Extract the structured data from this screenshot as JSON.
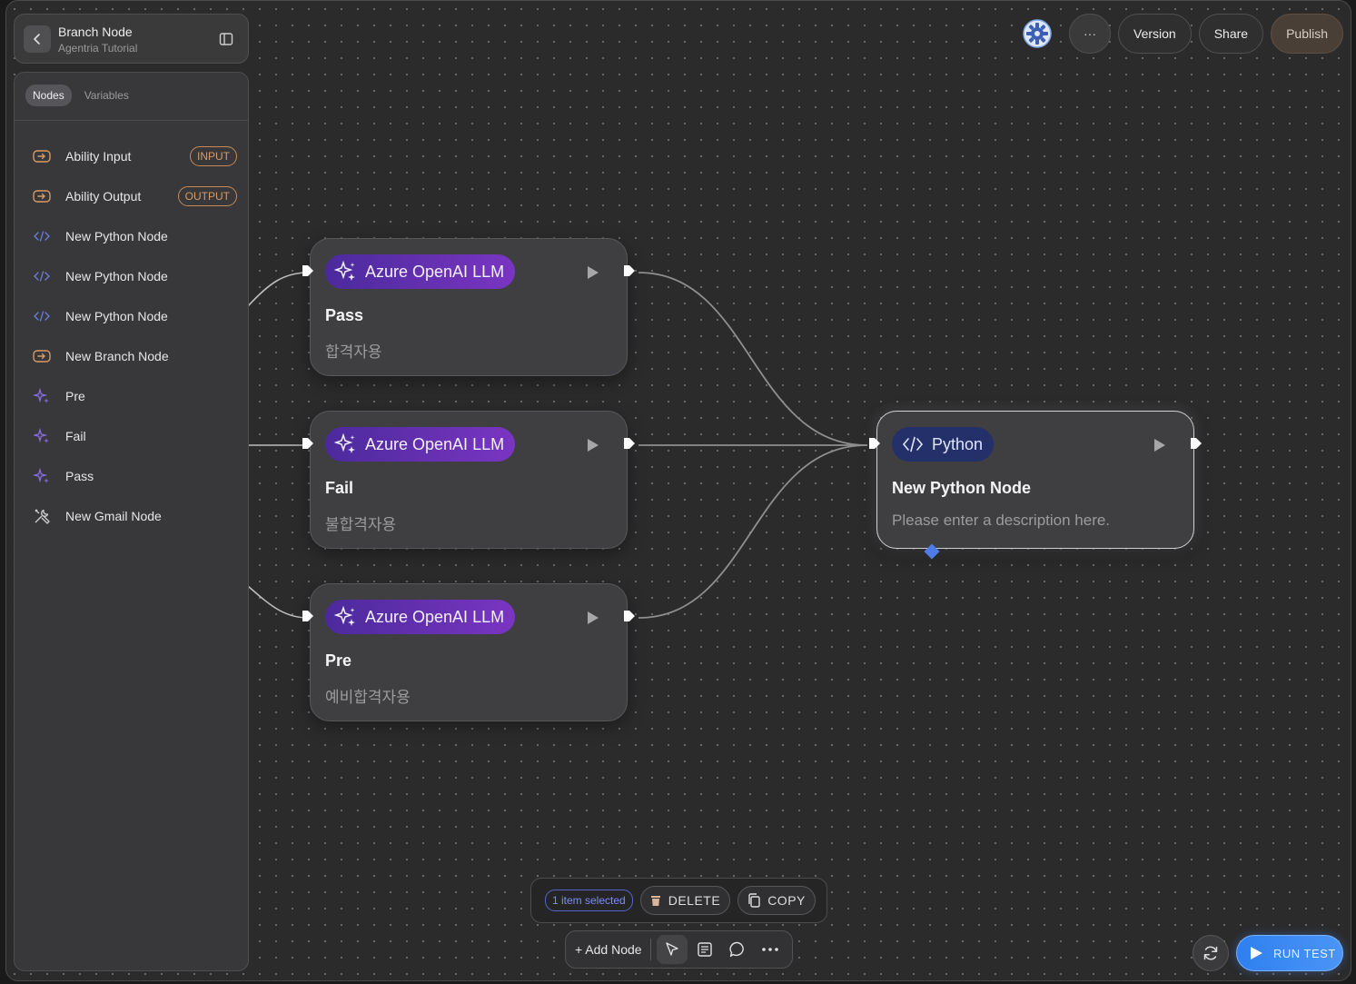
{
  "header": {
    "title": "Branch Node",
    "subtitle": "Agentria Tutorial"
  },
  "side_panel": {
    "tabs": [
      {
        "label": "Nodes",
        "active": true
      },
      {
        "label": "Variables",
        "active": false
      }
    ],
    "items": [
      {
        "label": "Ability Input",
        "icon": "io-arrow-icon",
        "badge": "INPUT"
      },
      {
        "label": "Ability Output",
        "icon": "io-arrow-icon",
        "badge": "OUTPUT"
      },
      {
        "label": "New Python Node",
        "icon": "code-icon"
      },
      {
        "label": "New Python Node",
        "icon": "code-icon"
      },
      {
        "label": "New Python Node",
        "icon": "code-icon"
      },
      {
        "label": "New Branch Node",
        "icon": "io-arrow-icon"
      },
      {
        "label": "Pre",
        "icon": "sparkle-icon"
      },
      {
        "label": "Fail",
        "icon": "sparkle-icon"
      },
      {
        "label": "Pass",
        "icon": "sparkle-icon"
      },
      {
        "label": "New Gmail Node",
        "icon": "tools-icon"
      }
    ]
  },
  "top_tools": {
    "more_label": "···",
    "version_label": "Version",
    "share_label": "Share",
    "publish_label": "Publish"
  },
  "canvas": {
    "nodes": [
      {
        "type_label": "Azure OpenAI LLM",
        "name": "Pass",
        "description": "합격자용"
      },
      {
        "type_label": "Azure OpenAI LLM",
        "name": "Fail",
        "description": "불합격자용"
      },
      {
        "type_label": "Azure OpenAI LLM",
        "name": "Pre",
        "description": "예비합격자용"
      },
      {
        "type_label": "Python",
        "name": "New Python Node",
        "description": "Please enter a description here."
      }
    ]
  },
  "selection_bar": {
    "count_label": "1 item selected",
    "delete_label": "DELETE",
    "copy_label": "COPY"
  },
  "bottom_toolbar": {
    "add_node_label": "+ Add Node"
  },
  "run": {
    "label": "RUN TEST"
  },
  "colors": {
    "accent_blue": "#2f7ff0",
    "llm_chip": "#7a35c2",
    "python_chip": "#23306a",
    "badge_orange": "#d69a66"
  }
}
